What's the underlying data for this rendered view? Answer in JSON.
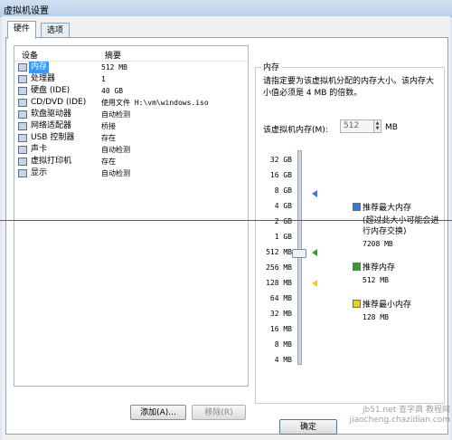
{
  "window": {
    "title": "虚拟机设置"
  },
  "tabs": [
    {
      "label": "硬件"
    },
    {
      "label": "选项"
    }
  ],
  "device_table": {
    "columns": {
      "device": "设备",
      "summary": "摘要"
    },
    "rows": [
      {
        "name": "内存",
        "summary": "512 MB",
        "icon": "memory-icon",
        "selected": true
      },
      {
        "name": "处理器",
        "summary": "1",
        "icon": "processor-icon"
      },
      {
        "name": "硬盘 (IDE)",
        "summary": "40 GB",
        "icon": "hard-disk-icon"
      },
      {
        "name": "CD/DVD (IDE)",
        "summary": "使用文件 H:\\vm\\windows.iso",
        "icon": "cd-dvd-icon"
      },
      {
        "name": "软盘驱动器",
        "summary": "自动检测",
        "icon": "floppy-icon"
      },
      {
        "name": "网络适配器",
        "summary": "桥接",
        "icon": "network-adapter-icon"
      },
      {
        "name": "USB 控制器",
        "summary": "存在",
        "icon": "usb-icon"
      },
      {
        "name": "声卡",
        "summary": "自动检测",
        "icon": "sound-card-icon"
      },
      {
        "name": "虚拟打印机",
        "summary": "存在",
        "icon": "printer-icon"
      },
      {
        "name": "显示",
        "summary": "自动检测",
        "icon": "display-icon"
      }
    ]
  },
  "buttons": {
    "add": "添加(A)...",
    "remove": "移除(R)",
    "ok": "确定"
  },
  "memory": {
    "group_title": "内存",
    "description": "请指定要为该虚拟机分配的内存大小。该内存大小值必须是 4 MB 的倍数。",
    "field_label": "该虚拟机内存(M):",
    "value": "512",
    "unit": "MB",
    "scale_labels": [
      "32 GB",
      "16 GB",
      "8 GB",
      "4 GB",
      "2 GB",
      "1 GB",
      "512 MB",
      "256 MB",
      "128 MB",
      "64 MB",
      "32 MB",
      "16 MB",
      "8 MB",
      "4 MB"
    ],
    "legend": {
      "max": {
        "title": "推荐最大内存",
        "note": "(超过此大小可能会进行内存交换)",
        "value": "7208 MB",
        "color": "#3a78d8"
      },
      "recommended": {
        "title": "推荐内存",
        "value": "512 MB",
        "color": "#2ea02e"
      },
      "min": {
        "title": "推荐最小内存",
        "value": "128 MB",
        "color": "#e6d21e"
      }
    }
  },
  "watermark": "jb51.net 查字典 教程网 jiaocheng.chazidian.com"
}
